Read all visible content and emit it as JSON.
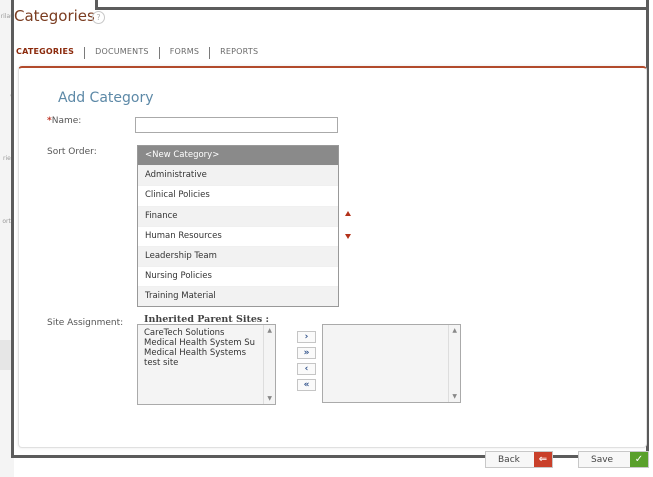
{
  "page": {
    "title": "Categories",
    "help_icon": "?"
  },
  "tabs": [
    {
      "label": "CATEGORIES",
      "active": true
    },
    {
      "label": "DOCUMENTS",
      "active": false
    },
    {
      "label": "FORMS",
      "active": false
    },
    {
      "label": "REPORTS",
      "active": false
    }
  ],
  "form": {
    "heading": "Add Category",
    "name_label": "Name:",
    "name_required_mark": "*",
    "name_value": "",
    "sort_order_label": "Sort Order:",
    "sort_items": [
      "<New Category>",
      "Administrative",
      "Clinical Policies",
      "Finance",
      "Human Resources",
      "Leadership Team",
      "Nursing Policies",
      "Training Material"
    ],
    "selected_sort_item": "<New Category>",
    "site_assignment_label": "Site Assignment:",
    "inherited_title": "Inherited Parent Sites :",
    "inherited_sites": [
      "CareTech Solutions",
      "Medical Health System Su",
      "Medical Health Systems",
      "test site"
    ],
    "assigned_sites": [],
    "move_buttons": {
      "add_one": "›",
      "add_all": "»",
      "remove_one": "‹",
      "remove_all": "«"
    }
  },
  "actions": {
    "back_label": "Back",
    "save_label": "Save"
  },
  "left_nav_fragments": [
    "rilau",
    "e",
    "ries",
    "orts"
  ],
  "colors": {
    "accent": "#b24b2c",
    "title": "#7a3c20",
    "heading": "#5d89a7",
    "back_icon_bg": "#c9402a",
    "save_icon_bg": "#5aa02c"
  },
  "icons": {
    "sort_up": "triangle-up",
    "sort_down": "triangle-down",
    "back": "left-arrow",
    "save": "checkmark"
  }
}
